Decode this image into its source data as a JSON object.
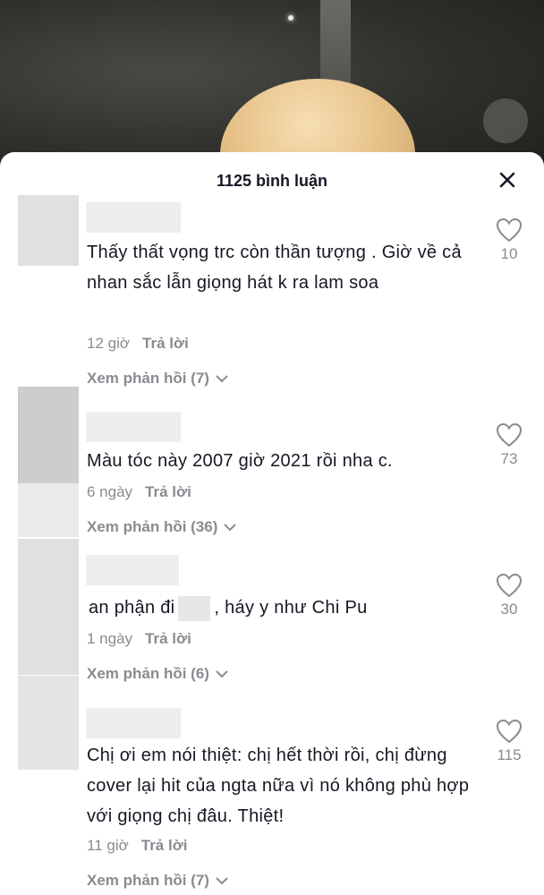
{
  "header": {
    "title": "1125 bình luận",
    "close_icon": "close-icon"
  },
  "comments": [
    {
      "text": "Thấy thất vọng trc còn thần tượng . Giờ về cả nhan sắc lẫn giọng hát k ra lam soa",
      "time": "12 giờ",
      "reply_label": "Trả lời",
      "view_replies": "Xem phản hồi (7)",
      "likes": "10"
    },
    {
      "text": "Màu tóc này 2007 giờ 2021 rồi nha c.",
      "time": "6 ngày",
      "reply_label": "Trả lời",
      "view_replies": "Xem phản hồi (36)",
      "likes": "73"
    },
    {
      "text_before": "an phận đi",
      "text_after": ", háy y như Chi Pu",
      "time": "1 ngày",
      "reply_label": "Trả lời",
      "view_replies": "Xem phản hồi (6)",
      "likes": "30"
    },
    {
      "text": "Chị ơi em nói thiệt: chị hết thời rồi, chị đừng cover lại hit của ngta nữa vì nó không phù hợp với giọng chị đâu. Thiệt!",
      "time": "11 giờ",
      "reply_label": "Trả lời",
      "view_replies": "Xem phản hồi (7)",
      "likes": "115"
    }
  ],
  "colors": {
    "text": "#161823",
    "muted": "#8a8b91",
    "placeholder": "#e2dfe0"
  }
}
